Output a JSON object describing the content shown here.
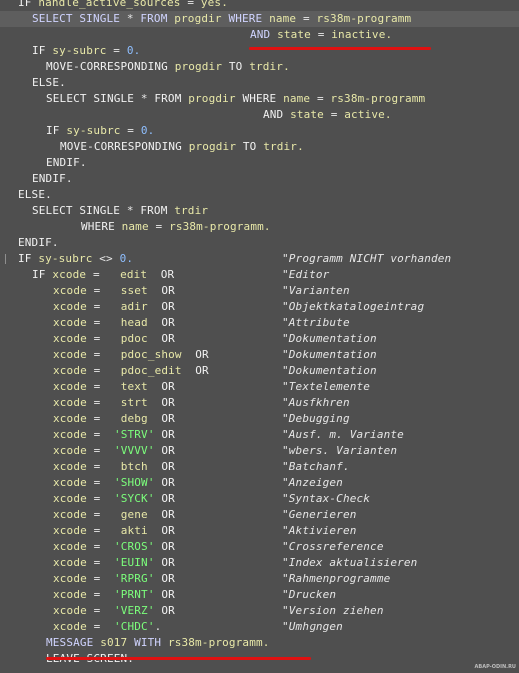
{
  "editor": {
    "lines": [
      [
        {
          "t": "IF ",
          "c": "kw"
        },
        {
          "t": "handle_active_sources",
          "c": "id"
        },
        {
          "t": " = ",
          "c": "op"
        },
        {
          "t": "yes.",
          "c": "id"
        }
      ],
      [
        {
          "t": "SELECT SINGLE ",
          "c": "kw2"
        },
        {
          "t": "* ",
          "c": "op"
        },
        {
          "t": "FROM ",
          "c": "kw2"
        },
        {
          "t": "progdir ",
          "c": "id"
        },
        {
          "t": "WHERE ",
          "c": "kw2"
        },
        {
          "t": "name ",
          "c": "id"
        },
        {
          "t": "= ",
          "c": "op"
        },
        {
          "t": "rs38m-programm",
          "c": "id"
        }
      ],
      [
        {
          "t": "AND ",
          "c": "kw2"
        },
        {
          "t": "state ",
          "c": "id"
        },
        {
          "t": "= ",
          "c": "op"
        },
        {
          "t": "inactive.",
          "c": "id"
        }
      ],
      [
        {
          "t": "IF ",
          "c": "kw"
        },
        {
          "t": "sy-subrc ",
          "c": "id"
        },
        {
          "t": "= ",
          "c": "op"
        },
        {
          "t": "0.",
          "c": "num"
        }
      ],
      [
        {
          "t": "MOVE-CORRESPONDING ",
          "c": "kw"
        },
        {
          "t": "progdir ",
          "c": "id"
        },
        {
          "t": "TO ",
          "c": "kw"
        },
        {
          "t": "trdir.",
          "c": "id"
        }
      ],
      [
        {
          "t": "ELSE.",
          "c": "kw"
        }
      ],
      [
        {
          "t": "SELECT SINGLE ",
          "c": "kw"
        },
        {
          "t": "* ",
          "c": "op"
        },
        {
          "t": "FROM ",
          "c": "kw"
        },
        {
          "t": "progdir ",
          "c": "id"
        },
        {
          "t": "WHERE ",
          "c": "kw"
        },
        {
          "t": "name ",
          "c": "id"
        },
        {
          "t": "= ",
          "c": "op"
        },
        {
          "t": "rs38m-programm",
          "c": "id"
        }
      ],
      [
        {
          "t": "AND ",
          "c": "kw"
        },
        {
          "t": "state ",
          "c": "id"
        },
        {
          "t": "= ",
          "c": "op"
        },
        {
          "t": "active.",
          "c": "id"
        }
      ],
      [
        {
          "t": "IF ",
          "c": "kw"
        },
        {
          "t": "sy-subrc ",
          "c": "id"
        },
        {
          "t": "= ",
          "c": "op"
        },
        {
          "t": "0.",
          "c": "num"
        }
      ],
      [
        {
          "t": "MOVE-CORRESPONDING ",
          "c": "kw"
        },
        {
          "t": "progdir ",
          "c": "id"
        },
        {
          "t": "TO ",
          "c": "kw"
        },
        {
          "t": "trdir.",
          "c": "id"
        }
      ],
      [
        {
          "t": "ENDIF.",
          "c": "kw"
        }
      ],
      [
        {
          "t": "ENDIF.",
          "c": "kw"
        }
      ],
      [
        {
          "t": "ELSE.",
          "c": "kw"
        }
      ],
      [
        {
          "t": "SELECT SINGLE ",
          "c": "kw"
        },
        {
          "t": "* ",
          "c": "op"
        },
        {
          "t": "FROM ",
          "c": "kw"
        },
        {
          "t": "trdir",
          "c": "id"
        }
      ],
      [
        {
          "t": "WHERE ",
          "c": "kw"
        },
        {
          "t": "name ",
          "c": "id"
        },
        {
          "t": "= ",
          "c": "op"
        },
        {
          "t": "rs38m-programm.",
          "c": "id"
        }
      ],
      [
        {
          "t": "ENDIF.",
          "c": "kw"
        }
      ],
      [
        {
          "t": "IF ",
          "c": "kw"
        },
        {
          "t": "sy-subrc ",
          "c": "id"
        },
        {
          "t": "<> ",
          "c": "op"
        },
        {
          "t": "0.",
          "c": "num"
        }
      ],
      [
        {
          "t": "IF ",
          "c": "kw"
        },
        {
          "t": "xcode ",
          "c": "id"
        },
        {
          "t": "=   ",
          "c": "op"
        },
        {
          "t": "edit  ",
          "c": "id"
        },
        {
          "t": "OR",
          "c": "kw"
        }
      ],
      [
        {
          "t": "xcode ",
          "c": "id"
        },
        {
          "t": "=   ",
          "c": "op"
        },
        {
          "t": "sset  ",
          "c": "id"
        },
        {
          "t": "OR",
          "c": "kw"
        }
      ],
      [
        {
          "t": "xcode ",
          "c": "id"
        },
        {
          "t": "=   ",
          "c": "op"
        },
        {
          "t": "adir  ",
          "c": "id"
        },
        {
          "t": "OR",
          "c": "kw"
        }
      ],
      [
        {
          "t": "xcode ",
          "c": "id"
        },
        {
          "t": "=   ",
          "c": "op"
        },
        {
          "t": "head  ",
          "c": "id"
        },
        {
          "t": "OR",
          "c": "kw"
        }
      ],
      [
        {
          "t": "xcode ",
          "c": "id"
        },
        {
          "t": "=   ",
          "c": "op"
        },
        {
          "t": "pdoc  ",
          "c": "id"
        },
        {
          "t": "OR",
          "c": "kw"
        }
      ],
      [
        {
          "t": "xcode ",
          "c": "id"
        },
        {
          "t": "=   ",
          "c": "op"
        },
        {
          "t": "pdoc_show  ",
          "c": "id"
        },
        {
          "t": "OR",
          "c": "kw"
        }
      ],
      [
        {
          "t": "xcode ",
          "c": "id"
        },
        {
          "t": "=   ",
          "c": "op"
        },
        {
          "t": "pdoc_edit  ",
          "c": "id"
        },
        {
          "t": "OR",
          "c": "kw"
        }
      ],
      [
        {
          "t": "xcode ",
          "c": "id"
        },
        {
          "t": "=   ",
          "c": "op"
        },
        {
          "t": "text  ",
          "c": "id"
        },
        {
          "t": "OR",
          "c": "kw"
        }
      ],
      [
        {
          "t": "xcode ",
          "c": "id"
        },
        {
          "t": "=   ",
          "c": "op"
        },
        {
          "t": "strt  ",
          "c": "id"
        },
        {
          "t": "OR",
          "c": "kw"
        }
      ],
      [
        {
          "t": "xcode ",
          "c": "id"
        },
        {
          "t": "=   ",
          "c": "op"
        },
        {
          "t": "debg  ",
          "c": "id"
        },
        {
          "t": "OR",
          "c": "kw"
        }
      ],
      [
        {
          "t": "xcode ",
          "c": "id"
        },
        {
          "t": "=  ",
          "c": "op"
        },
        {
          "t": "'STRV' ",
          "c": "str"
        },
        {
          "t": "OR",
          "c": "kw"
        }
      ],
      [
        {
          "t": "xcode ",
          "c": "id"
        },
        {
          "t": "=  ",
          "c": "op"
        },
        {
          "t": "'VVVV' ",
          "c": "str"
        },
        {
          "t": "OR",
          "c": "kw"
        }
      ],
      [
        {
          "t": "xcode ",
          "c": "id"
        },
        {
          "t": "=   ",
          "c": "op"
        },
        {
          "t": "btch  ",
          "c": "id"
        },
        {
          "t": "OR",
          "c": "kw"
        }
      ],
      [
        {
          "t": "xcode ",
          "c": "id"
        },
        {
          "t": "=  ",
          "c": "op"
        },
        {
          "t": "'SHOW' ",
          "c": "str"
        },
        {
          "t": "OR",
          "c": "kw"
        }
      ],
      [
        {
          "t": "xcode ",
          "c": "id"
        },
        {
          "t": "=  ",
          "c": "op"
        },
        {
          "t": "'SYCK' ",
          "c": "str"
        },
        {
          "t": "OR",
          "c": "kw"
        }
      ],
      [
        {
          "t": "xcode ",
          "c": "id"
        },
        {
          "t": "=   ",
          "c": "op"
        },
        {
          "t": "gene  ",
          "c": "id"
        },
        {
          "t": "OR",
          "c": "kw"
        }
      ],
      [
        {
          "t": "xcode ",
          "c": "id"
        },
        {
          "t": "=   ",
          "c": "op"
        },
        {
          "t": "akti  ",
          "c": "id"
        },
        {
          "t": "OR",
          "c": "kw"
        }
      ],
      [
        {
          "t": "xcode ",
          "c": "id"
        },
        {
          "t": "=  ",
          "c": "op"
        },
        {
          "t": "'CROS' ",
          "c": "str"
        },
        {
          "t": "OR",
          "c": "kw"
        }
      ],
      [
        {
          "t": "xcode ",
          "c": "id"
        },
        {
          "t": "=  ",
          "c": "op"
        },
        {
          "t": "'EUIN' ",
          "c": "str"
        },
        {
          "t": "OR",
          "c": "kw"
        }
      ],
      [
        {
          "t": "xcode ",
          "c": "id"
        },
        {
          "t": "=  ",
          "c": "op"
        },
        {
          "t": "'RPRG' ",
          "c": "str"
        },
        {
          "t": "OR",
          "c": "kw"
        }
      ],
      [
        {
          "t": "xcode ",
          "c": "id"
        },
        {
          "t": "=  ",
          "c": "op"
        },
        {
          "t": "'PRNT' ",
          "c": "str"
        },
        {
          "t": "OR",
          "c": "kw"
        }
      ],
      [
        {
          "t": "xcode ",
          "c": "id"
        },
        {
          "t": "=  ",
          "c": "op"
        },
        {
          "t": "'VERZ' ",
          "c": "str"
        },
        {
          "t": "OR",
          "c": "kw"
        }
      ],
      [
        {
          "t": "xcode ",
          "c": "id"
        },
        {
          "t": "=  ",
          "c": "op"
        },
        {
          "t": "'CHDC'",
          "c": "str"
        },
        {
          "t": ".",
          "c": "op"
        }
      ],
      [
        {
          "t": "MESSAGE ",
          "c": "kw2"
        },
        {
          "t": "s017 ",
          "c": "id"
        },
        {
          "t": "WITH ",
          "c": "kw2"
        },
        {
          "t": "rs38m-programm.",
          "c": "id"
        }
      ],
      [
        {
          "t": "LEAVE SCREEN.",
          "c": "kw"
        }
      ]
    ],
    "comments": {
      "16": "\"Programm NICHT vorhanden",
      "17": "\"Editor",
      "18": "\"Varianten",
      "19": "\"Objektkatalogeintrag",
      "20": "\"Attribute",
      "21": "\"Dokumentation",
      "22": "\"Dokumentation",
      "23": "\"Dokumentation",
      "24": "\"Textelemente",
      "25": "\"Ausfkhren",
      "26": "\"Debugging",
      "27": "\"Ausf. m. Variante",
      "28": "\"wbers. Varianten",
      "29": "\"Batchanf.",
      "30": "\"Anzeigen",
      "31": "\"Syntax-Check",
      "32": "\"Generieren",
      "33": "\"Aktivieren",
      "34": "\"Crossreference",
      "35": "\"Index aktualisieren",
      "36": "\"Rahmenprogramme",
      "37": "\"Drucken",
      "38": "\"Version ziehen",
      "39": "\"Umhɡngen"
    },
    "watermark": "ABAP-ODIN.RU",
    "colors": {
      "background": "#4f4f4f",
      "current_line": "#5e5e5e",
      "keyword": "#f2f2f2",
      "select_keyword": "#d0d4ff",
      "identifier": "#e8e8a8",
      "string_literal": "#7cff7c",
      "number": "#8fbfff",
      "comment": "#e6e6e6",
      "annotation_underline": "#e01111"
    }
  }
}
